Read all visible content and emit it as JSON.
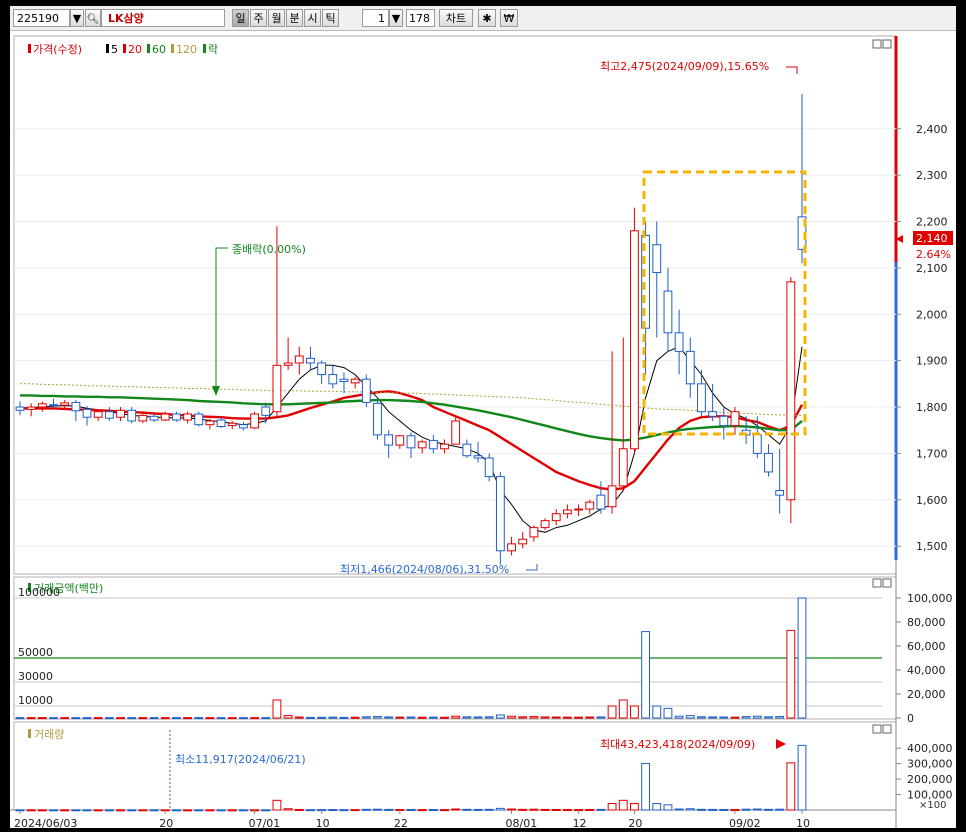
{
  "toolbar": {
    "code": "225190",
    "name": "LK삼양",
    "periods": [
      "일",
      "주",
      "월",
      "분",
      "시",
      "틱"
    ],
    "active_period": "일",
    "count_value": "1",
    "bars_value": "178",
    "chart_button": "차트",
    "settings_icon": "gear-icon",
    "currency_icon": "won-icon"
  },
  "legend": {
    "price_label": "가격(수정)",
    "ma_labels": [
      "5",
      "20",
      "60",
      "120"
    ],
    "ma_colors": [
      "#000000",
      "#e00000",
      "#11871a",
      "#b29a3c"
    ],
    "drop_label": "락"
  },
  "annotations": {
    "high": "최고2,475(2024/09/09),15.65%",
    "low": "최저1,466(2024/08/06),31.50%",
    "zero_drop": "종배락(0.00%)",
    "current_price": "2,140",
    "current_change": "2.64%",
    "vol_min": "최소11,917(2024/06/21)",
    "vol_max": "최대43,423,418(2024/09/09)"
  },
  "panels": {
    "amount_title": "거래금액(백만)",
    "volume_title": "거래량"
  },
  "colors": {
    "up": "#e00000",
    "down": "#1f5fc9",
    "highlight_box": "#f5b400",
    "ref_line": "#11871a"
  },
  "chart_data": [
    {
      "type": "candlestick",
      "title": "",
      "x_tick_labels": [
        "2024/06/03",
        "20",
        "07/01",
        "10",
        "22",
        "08/01",
        "12",
        "20",
        "09/02",
        "10"
      ],
      "y_ticks": [
        1500,
        1600,
        1700,
        1800,
        1900,
        2000,
        2100,
        2200,
        2300,
        2400
      ],
      "ylim": [
        1440,
        2600
      ],
      "series": [
        {
          "name": "가격(수정)",
          "ohlc": [
            [
              1800,
              1812,
              1782,
              1793
            ],
            [
              1795,
              1808,
              1780,
              1800
            ],
            [
              1800,
              1812,
              1790,
              1807
            ],
            [
              1805,
              1818,
              1798,
              1804
            ],
            [
              1804,
              1815,
              1795,
              1809
            ],
            [
              1810,
              1815,
              1770,
              1792
            ],
            [
              1795,
              1802,
              1760,
              1778
            ],
            [
              1778,
              1795,
              1770,
              1790
            ],
            [
              1790,
              1800,
              1770,
              1776
            ],
            [
              1778,
              1800,
              1770,
              1793
            ],
            [
              1793,
              1800,
              1765,
              1770
            ],
            [
              1770,
              1790,
              1765,
              1782
            ],
            [
              1780,
              1785,
              1768,
              1772
            ],
            [
              1772,
              1790,
              1770,
              1785
            ],
            [
              1785,
              1790,
              1768,
              1772
            ],
            [
              1772,
              1790,
              1765,
              1785
            ],
            [
              1785,
              1790,
              1758,
              1762
            ],
            [
              1762,
              1775,
              1752,
              1770
            ],
            [
              1772,
              1778,
              1755,
              1758
            ],
            [
              1760,
              1770,
              1752,
              1765
            ],
            [
              1762,
              1768,
              1750,
              1755
            ],
            [
              1755,
              1790,
              1752,
              1785
            ],
            [
              1800,
              1810,
              1765,
              1782
            ],
            [
              1790,
              2190,
              1780,
              1890
            ],
            [
              1890,
              1950,
              1880,
              1895
            ],
            [
              1895,
              1930,
              1870,
              1910
            ],
            [
              1905,
              1930,
              1880,
              1895
            ],
            [
              1895,
              1900,
              1850,
              1870
            ],
            [
              1870,
              1890,
              1840,
              1850
            ],
            [
              1860,
              1875,
              1830,
              1855
            ],
            [
              1852,
              1865,
              1840,
              1860
            ],
            [
              1860,
              1870,
              1800,
              1810
            ],
            [
              1808,
              1820,
              1730,
              1740
            ],
            [
              1740,
              1750,
              1690,
              1718
            ],
            [
              1718,
              1740,
              1710,
              1738
            ],
            [
              1738,
              1745,
              1690,
              1712
            ],
            [
              1712,
              1730,
              1700,
              1725
            ],
            [
              1728,
              1740,
              1700,
              1710
            ],
            [
              1710,
              1730,
              1700,
              1720
            ],
            [
              1720,
              1780,
              1720,
              1770
            ],
            [
              1720,
              1730,
              1690,
              1695
            ],
            [
              1695,
              1725,
              1680,
              1690
            ],
            [
              1690,
              1700,
              1640,
              1650
            ],
            [
              1650,
              1660,
              1460,
              1490
            ],
            [
              1490,
              1520,
              1480,
              1505
            ],
            [
              1505,
              1530,
              1495,
              1515
            ],
            [
              1520,
              1545,
              1510,
              1540
            ],
            [
              1540,
              1560,
              1535,
              1555
            ],
            [
              1555,
              1580,
              1545,
              1570
            ],
            [
              1570,
              1590,
              1560,
              1578
            ],
            [
              1578,
              1590,
              1565,
              1580
            ],
            [
              1580,
              1600,
              1570,
              1595
            ],
            [
              1610,
              1640,
              1570,
              1580
            ],
            [
              1585,
              1920,
              1570,
              1630
            ],
            [
              1630,
              1950,
              1620,
              1710
            ],
            [
              1710,
              2230,
              1700,
              2180
            ],
            [
              2170,
              2200,
              1870,
              1970
            ],
            [
              2150,
              2200,
              1950,
              2090
            ],
            [
              2050,
              2100,
              1920,
              1960
            ],
            [
              1960,
              2010,
              1870,
              1920
            ],
            [
              1920,
              1950,
              1820,
              1850
            ],
            [
              1850,
              1880,
              1780,
              1790
            ],
            [
              1790,
              1850,
              1770,
              1780
            ],
            [
              1780,
              1800,
              1730,
              1760
            ],
            [
              1760,
              1800,
              1740,
              1790
            ],
            [
              1750,
              1780,
              1720,
              1740
            ],
            [
              1740,
              1780,
              1690,
              1700
            ],
            [
              1700,
              1720,
              1650,
              1660
            ],
            [
              1620,
              1710,
              1570,
              1610
            ],
            [
              1600,
              2080,
              1550,
              2070
            ],
            [
              2210,
              2475,
              2110,
              2140
            ]
          ]
        },
        {
          "name": "5",
          "values": [
            1798,
            1799,
            1800,
            1802,
            1803,
            1802,
            1797,
            1794,
            1790,
            1786,
            1782,
            1780,
            1778,
            1778,
            1776,
            1777,
            1774,
            1771,
            1768,
            1765,
            1762,
            1765,
            1770,
            1800,
            1830,
            1860,
            1880,
            1890,
            1890,
            1885,
            1870,
            1845,
            1820,
            1790,
            1770,
            1750,
            1735,
            1725,
            1720,
            1715,
            1710,
            1700,
            1680,
            1620,
            1590,
            1555,
            1535,
            1530,
            1540,
            1545,
            1555,
            1565,
            1580,
            1590,
            1620,
            1700,
            1820,
            1900,
            1920,
            1930,
            1900,
            1870,
            1830,
            1800,
            1785,
            1775,
            1760,
            1740,
            1720,
            1760,
            1930
          ]
        },
        {
          "name": "20",
          "values": [
            1797,
            1797,
            1797,
            1797,
            1796,
            1795,
            1794,
            1793,
            1792,
            1790,
            1789,
            1788,
            1786,
            1785,
            1783,
            1782,
            1780,
            1779,
            1778,
            1776,
            1775,
            1775,
            1775,
            1778,
            1782,
            1790,
            1798,
            1805,
            1812,
            1820,
            1824,
            1828,
            1832,
            1834,
            1830,
            1823,
            1815,
            1800,
            1790,
            1780,
            1770,
            1760,
            1750,
            1735,
            1720,
            1705,
            1690,
            1675,
            1660,
            1650,
            1640,
            1632,
            1625,
            1622,
            1625,
            1640,
            1670,
            1700,
            1730,
            1755,
            1770,
            1778,
            1780,
            1780,
            1778,
            1772,
            1768,
            1758,
            1750,
            1760,
            1805
          ]
        },
        {
          "name": "60",
          "values": [
            1825,
            1825,
            1824,
            1824,
            1823,
            1823,
            1822,
            1822,
            1821,
            1821,
            1820,
            1819,
            1818,
            1817,
            1816,
            1815,
            1813,
            1812,
            1811,
            1810,
            1808,
            1807,
            1806,
            1806,
            1806,
            1807,
            1808,
            1809,
            1810,
            1812,
            1813,
            1814,
            1815,
            1815,
            1814,
            1813,
            1811,
            1808,
            1805,
            1801,
            1797,
            1793,
            1788,
            1783,
            1778,
            1772,
            1766,
            1760,
            1754,
            1748,
            1742,
            1737,
            1733,
            1730,
            1728,
            1730,
            1734,
            1740,
            1745,
            1750,
            1753,
            1755,
            1757,
            1758,
            1759,
            1758,
            1756,
            1753,
            1750,
            1750,
            1770
          ]
        },
        {
          "name": "120",
          "values": [
            1850,
            1850,
            1849,
            1848,
            1848,
            1847,
            1846,
            1846,
            1845,
            1844,
            1844,
            1843,
            1842,
            1842,
            1841,
            1840,
            1840,
            1839,
            1838,
            1838,
            1837,
            1836,
            1836,
            1835,
            1835,
            1835,
            1834,
            1834,
            1834,
            1833,
            1833,
            1832,
            1832,
            1831,
            1830,
            1830,
            1829,
            1828,
            1827,
            1826,
            1825,
            1824,
            1823,
            1822,
            1821,
            1820,
            1818,
            1816,
            1814,
            1812,
            1810,
            1808,
            1806,
            1804,
            1802,
            1800,
            1798,
            1796,
            1795,
            1794,
            1793,
            1792,
            1790,
            1788,
            1787,
            1786,
            1785,
            1784,
            1783,
            1782,
            1782
          ]
        }
      ]
    },
    {
      "type": "bar",
      "title": "거래금액(백만)",
      "y_ticks": [
        0,
        20000,
        40000,
        60000,
        80000,
        100000
      ],
      "left_labels": [
        "100000",
        "50000",
        "30000",
        "10000"
      ],
      "ylim": [
        0,
        100000
      ],
      "reference_line": 50000,
      "values": [
        300,
        300,
        300,
        300,
        300,
        300,
        300,
        300,
        300,
        300,
        300,
        300,
        300,
        300,
        300,
        300,
        300,
        300,
        300,
        300,
        300,
        300,
        300,
        15000,
        2000,
        800,
        500,
        600,
        700,
        500,
        600,
        1000,
        1200,
        900,
        700,
        800,
        600,
        700,
        600,
        1500,
        1000,
        900,
        1000,
        2500,
        1500,
        1000,
        1200,
        900,
        800,
        700,
        700,
        800,
        900,
        10000,
        15000,
        10000,
        72000,
        10000,
        8000,
        1500,
        2000,
        1000,
        900,
        800,
        700,
        1200,
        1500,
        1000,
        1200,
        73000,
        100000
      ]
    },
    {
      "type": "bar",
      "title": "거래량",
      "y_ticks": [
        100000,
        200000,
        300000,
        400000
      ],
      "ylim": [
        0,
        440000
      ],
      "unit_label": "×100"
    }
  ]
}
